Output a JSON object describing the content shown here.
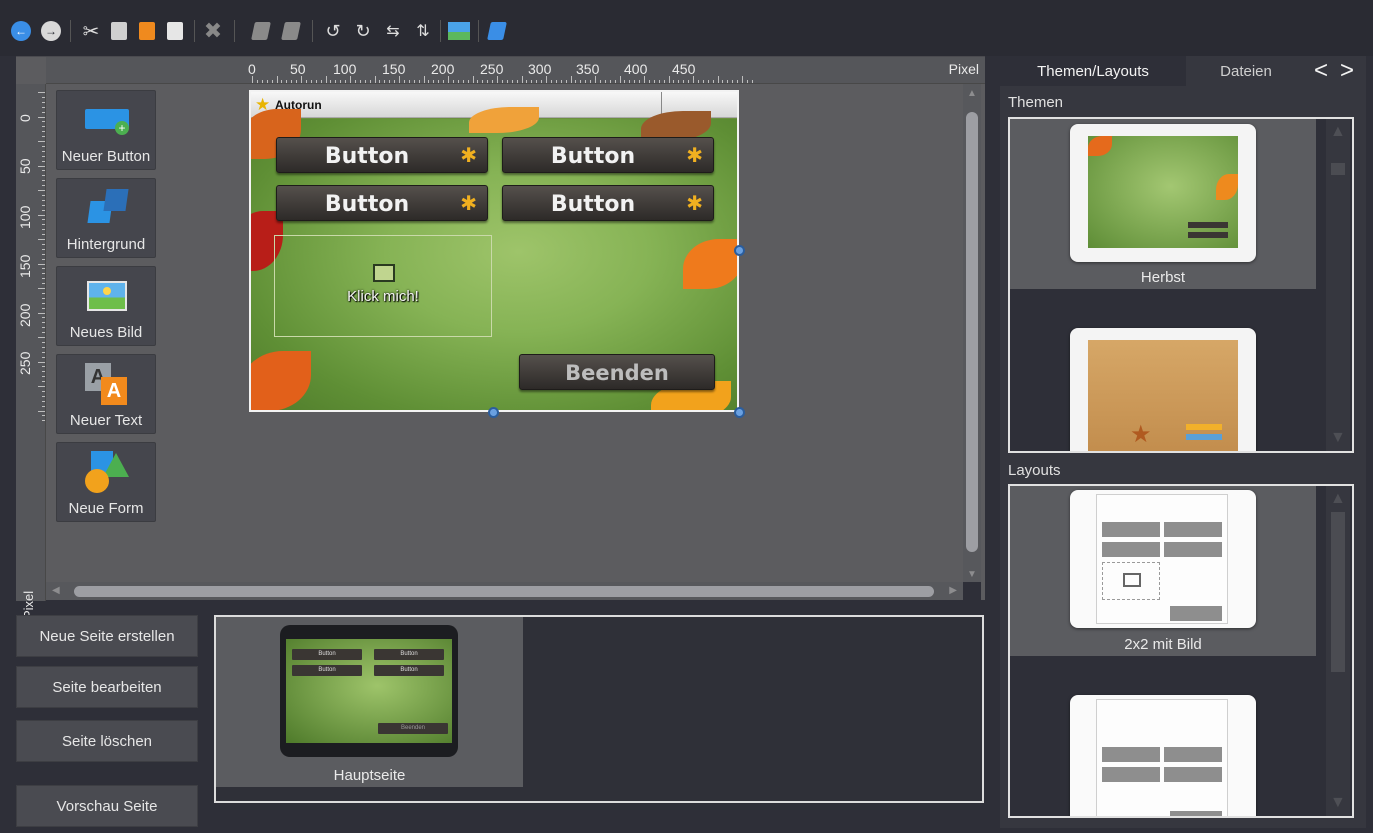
{
  "toolbar": {
    "icons": [
      "back-icon",
      "forward-icon",
      "cut-icon",
      "paste-icon",
      "paste-special-icon",
      "copy-icon",
      "delete-icon",
      "bring-front-icon",
      "send-back-icon",
      "rotate-left-icon",
      "rotate-right-icon",
      "flip-horizontal-icon",
      "flip-vertical-icon",
      "image-icon",
      "background-icon"
    ]
  },
  "ruler": {
    "unit": "Pixel",
    "top_ticks": [
      "0",
      "50",
      "100",
      "150",
      "200",
      "250",
      "300",
      "350",
      "400",
      "450"
    ],
    "left_ticks": [
      "0",
      "50",
      "100",
      "150",
      "200",
      "250"
    ]
  },
  "tools": [
    {
      "label": "Neuer Button",
      "icon": "new-button-icon"
    },
    {
      "label": "Hintergrund",
      "icon": "background-icon"
    },
    {
      "label": "Neues Bild",
      "icon": "new-image-icon"
    },
    {
      "label": "Neuer Text",
      "icon": "new-text-icon"
    },
    {
      "label": "Neue Form",
      "icon": "new-shape-icon"
    }
  ],
  "document": {
    "window_title": "Autorun",
    "buttons": [
      "Button",
      "Button",
      "Button",
      "Button"
    ],
    "image_label": "Klick mich!",
    "exit_button": "Beenden"
  },
  "page_actions": {
    "create": "Neue Seite erstellen",
    "edit": "Seite bearbeiten",
    "delete": "Seite löschen",
    "preview": "Vorschau Seite"
  },
  "pages": [
    {
      "name": "Hauptseite",
      "mini_buttons": [
        "Button",
        "Button",
        "Button",
        "Button"
      ],
      "mini_exit": "Beenden"
    }
  ],
  "right_panel": {
    "tabs": [
      "Themen/Layouts",
      "Dateien"
    ],
    "prev": "<",
    "next": ">",
    "themes_label": "Themen",
    "themes": [
      {
        "name": "Herbst"
      }
    ],
    "layouts_label": "Layouts",
    "layouts": [
      {
        "name": "2x2 mit Bild"
      }
    ]
  },
  "colors": {
    "background": "#2e2f38",
    "canvas": "#5c5c5f",
    "accent_blue": "#3a8ee6",
    "autumn_green": "#86b355"
  }
}
